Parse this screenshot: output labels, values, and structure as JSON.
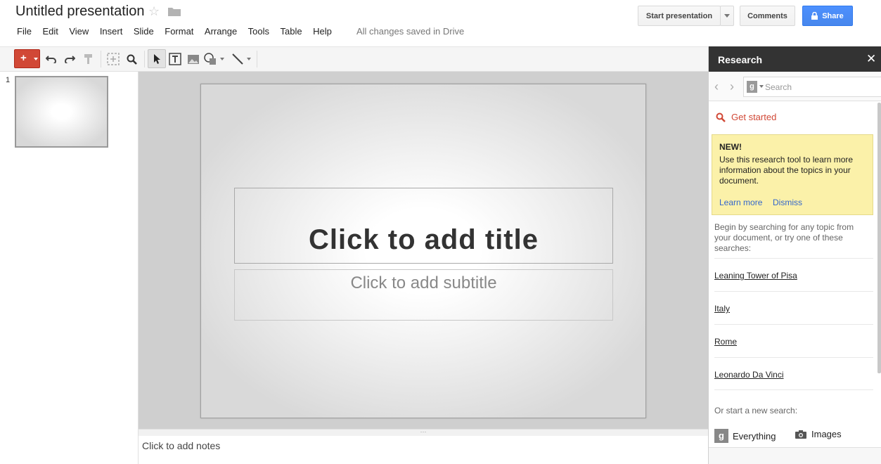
{
  "header": {
    "doc_title": "Untitled presentation",
    "save_status": "All changes saved in Drive",
    "start_presentation": "Start presentation",
    "comments": "Comments",
    "share": "Share"
  },
  "menu": [
    "File",
    "Edit",
    "View",
    "Insert",
    "Slide",
    "Format",
    "Arrange",
    "Tools",
    "Table",
    "Help"
  ],
  "filmstrip": {
    "slide_number": "1"
  },
  "slide": {
    "title_placeholder": "Click to add title",
    "subtitle_placeholder": "Click to add subtitle"
  },
  "notes": {
    "placeholder": "Click to add notes"
  },
  "research": {
    "title": "Research",
    "search_placeholder": "Search",
    "get_started": "Get started",
    "new_title": "NEW!",
    "new_desc": "Use this research tool to learn more information about the topics in your document.",
    "learn_more": "Learn more",
    "dismiss": "Dismiss",
    "begin_text": "Begin by searching for any topic from your document, or try one of these searches:",
    "suggestions": [
      "Leaning Tower of Pisa",
      "Italy",
      "Rome",
      "Leonardo Da Vinci"
    ],
    "start_new": "Or start a new search:",
    "everything": "Everything",
    "images": "Images"
  },
  "colors": {
    "accent_red": "#d14836",
    "share_blue": "#4d90fe",
    "research_header": "#333333",
    "new_box": "#fbf1a9",
    "link_blue": "#3366cc"
  }
}
